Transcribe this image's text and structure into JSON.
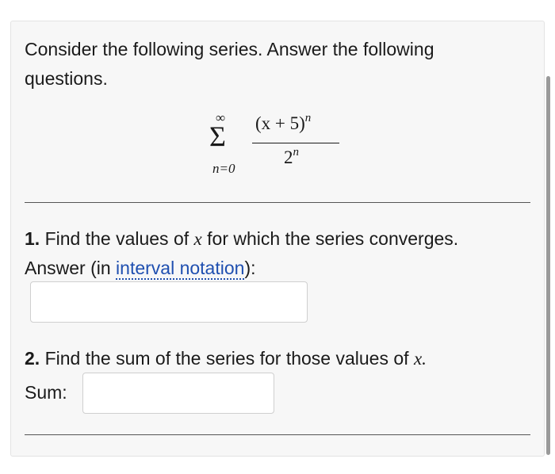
{
  "prompt": {
    "text": "Consider the following series. Answer the following questions."
  },
  "series": {
    "sigma": "Σ",
    "upper_limit": "∞",
    "lower_limit": "n=0",
    "numerator_base": "(x + 5)",
    "numerator_exponent": "n",
    "denominator_base": "2",
    "denominator_exponent": "n"
  },
  "question1": {
    "number": "1.",
    "text_before_var": "Find the values of",
    "variable": "x",
    "text_after_var": "for which the series converges.",
    "answer_prefix": "Answer (in",
    "link_text": "interval notation",
    "answer_suffix": "):",
    "input_value": ""
  },
  "question2": {
    "number": "2.",
    "text_before_var": "Find the sum of the series for those values of",
    "variable": "x",
    "period": ".",
    "sum_label": "Sum:",
    "input_value": ""
  },
  "colors": {
    "link": "#1f4fb0",
    "card_background": "#f7f7f7"
  }
}
